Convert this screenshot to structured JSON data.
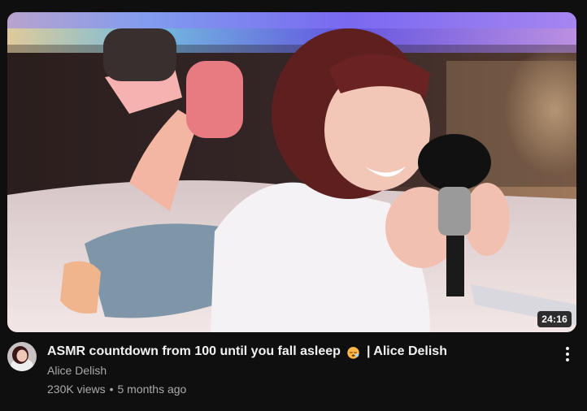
{
  "video": {
    "title": "ASMR countdown from 100 until you fall asleep",
    "title_emoji_icon": "sleeping-face-icon",
    "title_suffix": "| Alice Delish",
    "duration": "24:16",
    "channel": "Alice Delish",
    "views": "230K views",
    "separator": "•",
    "published": "5 months ago"
  },
  "icons": {
    "menu": "more-vert-icon"
  }
}
